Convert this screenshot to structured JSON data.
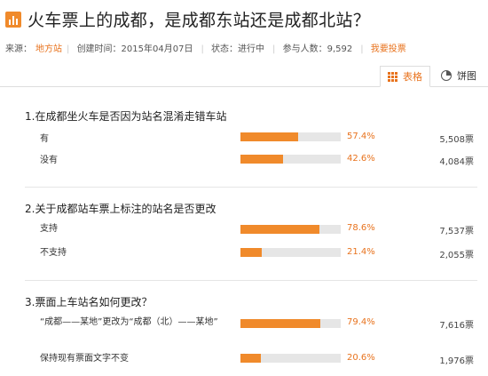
{
  "header": {
    "title": "火车票上的成都，是成都东站还是成都北站？"
  },
  "meta": {
    "source_label": "来源：",
    "source_value": "地方站",
    "created": "创建时间：2015年04月07日",
    "status": "状态：进行中",
    "participants": "参与人数：9,592",
    "vote_link": "我要投票"
  },
  "views": {
    "table_label": "表格",
    "pie_label": "饼图",
    "active": "table"
  },
  "colors": {
    "accent": "#f08a2b",
    "bar_bg": "#e6e6e6"
  },
  "questions": [
    {
      "title": "1.在成都坐火车是否因为站名混淆走错车站",
      "options": [
        {
          "label": "有",
          "percent_text": "57.4%",
          "percent": 57.4,
          "count": "5,508票"
        },
        {
          "label": "没有",
          "percent_text": "42.6%",
          "percent": 42.6,
          "count": "4,084票"
        }
      ]
    },
    {
      "title": "2.关于成都站车票上标注的站名是否更改",
      "options": [
        {
          "label": "支持",
          "percent_text": "78.6%",
          "percent": 78.6,
          "count": "7,537票"
        },
        {
          "label": "不支持",
          "percent_text": "21.4%",
          "percent": 21.4,
          "count": "2,055票"
        }
      ]
    },
    {
      "title": "3.票面上车站名如何更改？",
      "options": [
        {
          "label": "“成都——某地”更改为“成都（北）——某地”",
          "percent_text": "79.4%",
          "percent": 79.4,
          "count": "7,616票"
        },
        {
          "label": "保持现有票面文字不变",
          "percent_text": "20.6%",
          "percent": 20.6,
          "count": "1,976票"
        }
      ]
    }
  ]
}
